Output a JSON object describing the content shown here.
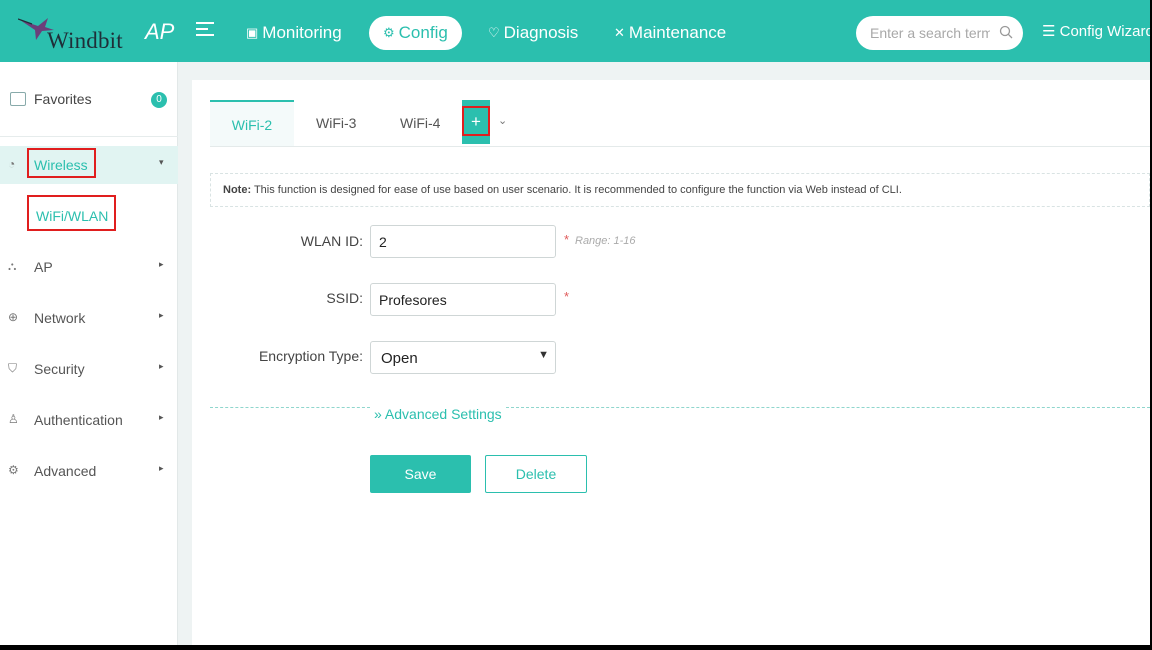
{
  "header": {
    "brand": "Windbit",
    "product": "AP",
    "nav": [
      {
        "icon": "monitor-icon",
        "label": "Monitoring"
      },
      {
        "icon": "gear-icon",
        "label": "Config"
      },
      {
        "icon": "diagnosis-icon",
        "label": "Diagnosis"
      },
      {
        "icon": "tools-icon",
        "label": "Maintenance"
      }
    ],
    "search_placeholder": "Enter a search term",
    "wizard_label": "Config Wizard"
  },
  "sidebar": {
    "favorites": {
      "label": "Favorites",
      "count": "0"
    },
    "items": [
      {
        "icon": "wifi-icon",
        "label": "Wireless"
      },
      {
        "icon": "ap-icon",
        "label": "AP"
      },
      {
        "icon": "globe-icon",
        "label": "Network"
      },
      {
        "icon": "shield-icon",
        "label": "Security"
      },
      {
        "icon": "user-icon",
        "label": "Authentication"
      },
      {
        "icon": "settings-icon",
        "label": "Advanced"
      }
    ],
    "sub_item": "WiFi/WLAN"
  },
  "main": {
    "tabs": [
      "WiFi-2",
      "WiFi-3",
      "WiFi-4"
    ],
    "add_tab": "+",
    "note_label": "Note:",
    "note_text": " This function is designed for ease of use based on user scenario. It is recommended to configure the function via Web instead of CLI.",
    "form": {
      "wlan_id_label": "WLAN ID:",
      "wlan_id_value": "2",
      "wlan_id_hint": "Range: 1-16",
      "ssid_label": "SSID:",
      "ssid_value": "Profesores",
      "encryption_label": "Encryption Type:",
      "encryption_value": "Open",
      "required_mark": "*"
    },
    "advanced_label": "Advanced Settings",
    "save_label": "Save",
    "delete_label": "Delete"
  },
  "colors": {
    "accent": "#2bbfae",
    "highlight": "#e01e1e"
  }
}
